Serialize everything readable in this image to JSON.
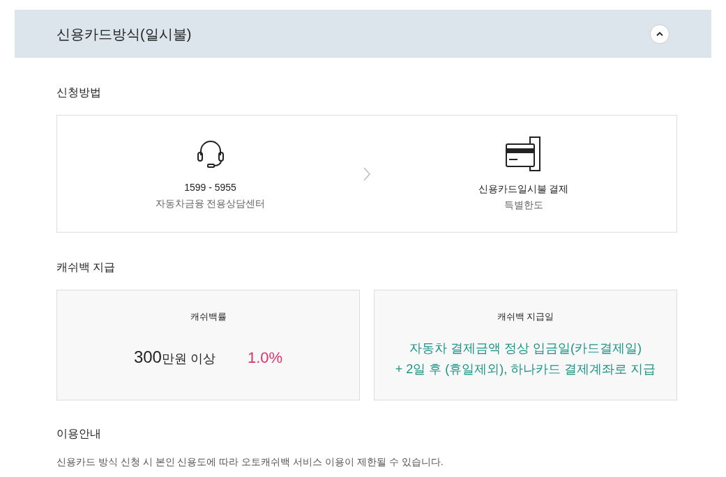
{
  "accordion": {
    "title": "신용카드방식(일시불)",
    "expanded": true
  },
  "apply_method": {
    "heading": "신청방법",
    "steps": [
      {
        "kind": "headset",
        "title": "1599 - 5955",
        "subtitle": "자동차금융 전용상담센터"
      },
      {
        "kind": "card",
        "title": "신용카드일시불 결제",
        "subtitle": "특별한도"
      }
    ]
  },
  "cashback": {
    "heading": "캐쉬백 지급",
    "rate_card": {
      "label": "캐쉬백률",
      "amount": "300",
      "amount_unit": "만원 이상",
      "rate": "1.0%"
    },
    "date_card": {
      "label": "캐쉬백 지급일",
      "lines": [
        "자동차 결제금액 정상 입금일(카드결제일)",
        "+ 2일 후 (휴일제외), 하나카드 결제계좌로 지급"
      ]
    }
  },
  "notice": {
    "heading": "이용안내",
    "text": "신용카드 방식 신청 시 본인 신용도에 따라 오토캐쉬백 서비스 이용이 제한될 수 있습니다."
  }
}
